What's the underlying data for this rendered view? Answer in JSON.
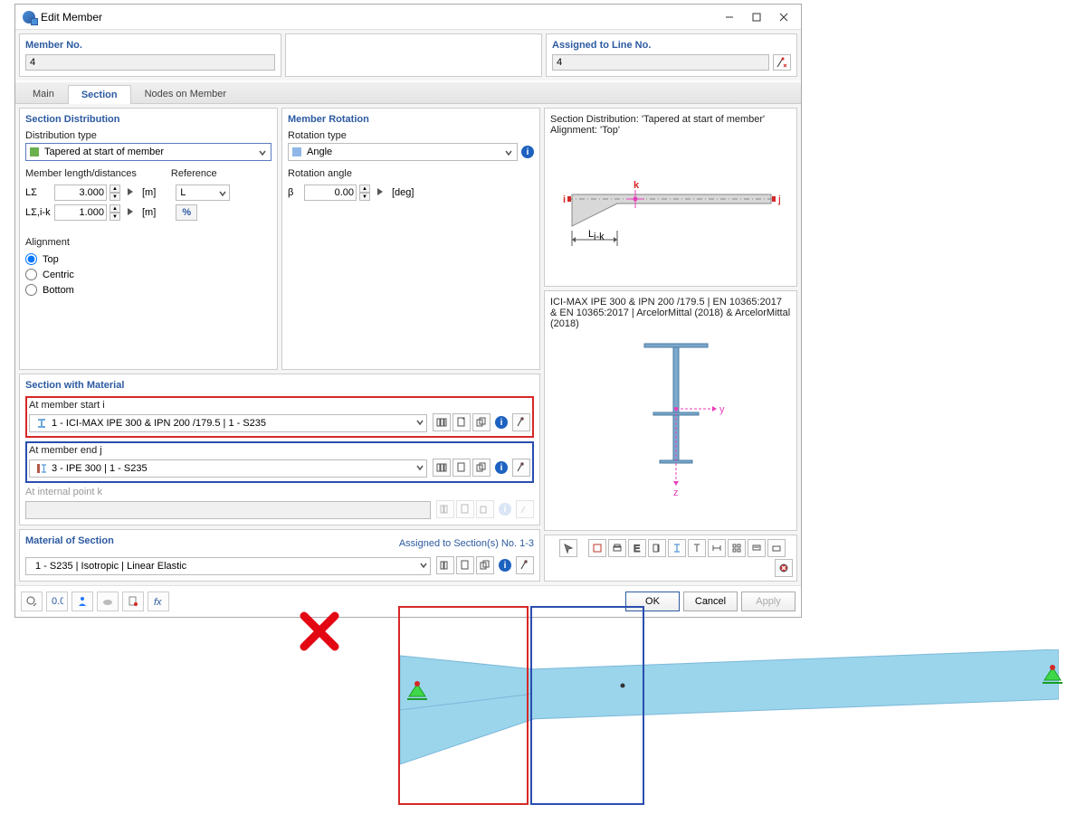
{
  "window": {
    "title": "Edit Member"
  },
  "top": {
    "member_no_label": "Member No.",
    "member_no_value": "4",
    "assigned_label": "Assigned to Line No.",
    "assigned_value": "4"
  },
  "tabs": {
    "main": "Main",
    "section": "Section",
    "nodes": "Nodes on Member"
  },
  "sec_dist": {
    "title": "Section Distribution",
    "dist_type_label": "Distribution type",
    "dist_type_value": "Tapered at start of member",
    "memlen_label": "Member length/distances",
    "ref_label": "Reference",
    "ls_label": "LΣ",
    "ls_value": "3.000",
    "ls_unit": "[m]",
    "ref_value": "L",
    "lsik_label": "LΣ,i-k",
    "lsik_value": "1.000",
    "lsik_unit": "[m]",
    "pct": "%",
    "align_label": "Alignment",
    "align_opts": [
      "Top",
      "Centric",
      "Bottom"
    ]
  },
  "rot": {
    "title": "Member Rotation",
    "type_label": "Rotation type",
    "type_value": "Angle",
    "angle_label": "Rotation angle",
    "beta": "β",
    "beta_value": "0.00",
    "beta_unit": "[deg]"
  },
  "secmat": {
    "title": "Section with Material",
    "start_label": "At member start i",
    "start_value": "1 - ICI-MAX IPE 300 & IPN 200 /179.5 | 1 - S235",
    "end_label": "At member end j",
    "end_value": "3 - IPE 300 | 1 - S235",
    "intk_label": "At internal point k"
  },
  "mat": {
    "title": "Material of Section",
    "assigned": "Assigned to Section(s) No. 1-3",
    "value": "1 - S235 | Isotropic | Linear Elastic"
  },
  "preview": {
    "line1": "Section Distribution: 'Tapered at start of member'",
    "line2": "Alignment: 'Top'",
    "k": "k",
    "i": "i",
    "j": "j",
    "lik": "L",
    "lik_sub": "i-k",
    "desc": "ICI-MAX IPE 300 & IPN 200 /179.5 | EN 10365:2017 & EN 10365:2017 | ArcelorMittal (2018) & ArcelorMittal (2018)",
    "ax_y": "y",
    "ax_z": "z"
  },
  "buttons": {
    "ok": "OK",
    "cancel": "Cancel",
    "apply": "Apply"
  },
  "colors": {
    "green_sq": "#6ab04c",
    "blue_sq": "#8fb7e8",
    "red_accent": "#d62828",
    "blue_accent": "#2a4db0",
    "cyan": "#9ad5ec",
    "magenta": "#e83ebb"
  }
}
